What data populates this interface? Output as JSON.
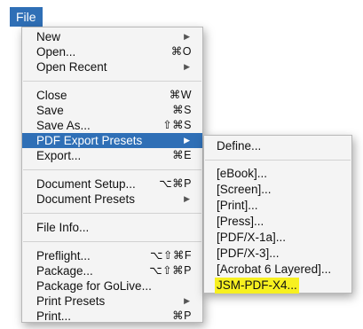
{
  "menubar": {
    "title": "File"
  },
  "main_menu": {
    "items": [
      {
        "label": "New",
        "shortcut": "",
        "submenu": true
      },
      {
        "label": "Open...",
        "shortcut": "⌘O",
        "submenu": false
      },
      {
        "label": "Open Recent",
        "shortcut": "",
        "submenu": true
      },
      {
        "label": "Close",
        "shortcut": "⌘W",
        "submenu": false
      },
      {
        "label": "Save",
        "shortcut": "⌘S",
        "submenu": false
      },
      {
        "label": "Save As...",
        "shortcut": "⇧⌘S",
        "submenu": false
      },
      {
        "label": "PDF Export Presets",
        "shortcut": "",
        "submenu": true,
        "selected": true
      },
      {
        "label": "Export...",
        "shortcut": "⌘E",
        "submenu": false
      },
      {
        "label": "Document Setup...",
        "shortcut": "⌥⌘P",
        "submenu": false
      },
      {
        "label": "Document Presets",
        "shortcut": "",
        "submenu": true
      },
      {
        "label": "File Info...",
        "shortcut": "",
        "submenu": false
      },
      {
        "label": "Preflight...",
        "shortcut": "⌥⇧⌘F",
        "submenu": false
      },
      {
        "label": "Package...",
        "shortcut": "⌥⇧⌘P",
        "submenu": false
      },
      {
        "label": "Package for GoLive...",
        "shortcut": "",
        "submenu": false
      },
      {
        "label": "Print Presets",
        "shortcut": "",
        "submenu": true
      },
      {
        "label": "Print...",
        "shortcut": "⌘P",
        "submenu": false
      }
    ],
    "arrow_glyph": "▶"
  },
  "sub_menu": {
    "items": [
      {
        "label": "Define..."
      },
      {
        "label": "[eBook]..."
      },
      {
        "label": "[Screen]..."
      },
      {
        "label": "[Print]..."
      },
      {
        "label": "[Press]..."
      },
      {
        "label": "[PDF/X-1a]..."
      },
      {
        "label": "[PDF/X-3]..."
      },
      {
        "label": "[Acrobat 6 Layered]..."
      },
      {
        "label": "JSM-PDF-X4..."
      }
    ]
  },
  "colors": {
    "selection": "#2f6fb6",
    "highlight": "#f7f020",
    "menu_background": "#f4f4f4"
  }
}
